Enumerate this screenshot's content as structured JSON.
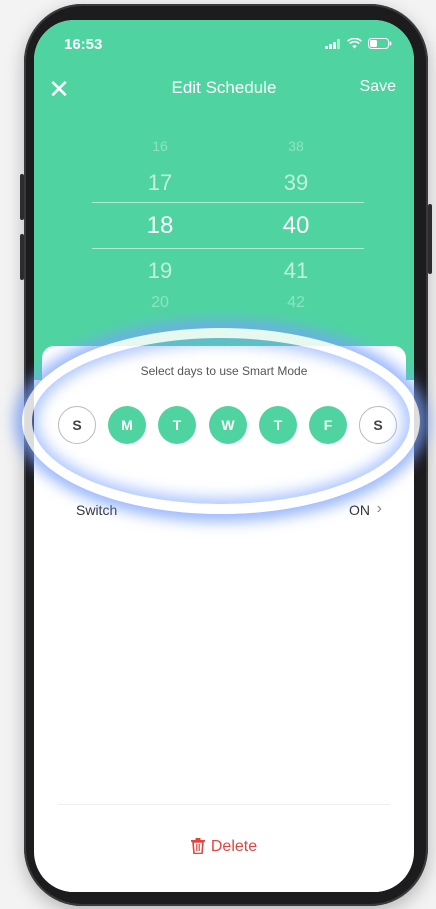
{
  "status": {
    "time": "16:53"
  },
  "nav": {
    "close_glyph": "✕",
    "title": "Edit Schedule",
    "save_label": "Save"
  },
  "picker": {
    "hours": [
      "16",
      "17",
      "18",
      "19",
      "20"
    ],
    "minutes": [
      "38",
      "39",
      "40",
      "41",
      "42"
    ],
    "selected_hour": "18",
    "selected_minute": "40"
  },
  "days_section": {
    "hint": "Select days to use Smart Mode",
    "days": [
      {
        "label": "S",
        "selected": false
      },
      {
        "label": "M",
        "selected": true
      },
      {
        "label": "T",
        "selected": true
      },
      {
        "label": "W",
        "selected": true
      },
      {
        "label": "T",
        "selected": true
      },
      {
        "label": "F",
        "selected": true
      },
      {
        "label": "S",
        "selected": false
      }
    ]
  },
  "switch_row": {
    "label": "Switch",
    "value": "ON"
  },
  "delete": {
    "label": "Delete"
  },
  "colors": {
    "accent": "#4fd4a1",
    "danger": "#e0463f"
  },
  "icons": {
    "close": "close-icon",
    "chevron": "chevron-right-icon",
    "trash": "trash-icon"
  }
}
